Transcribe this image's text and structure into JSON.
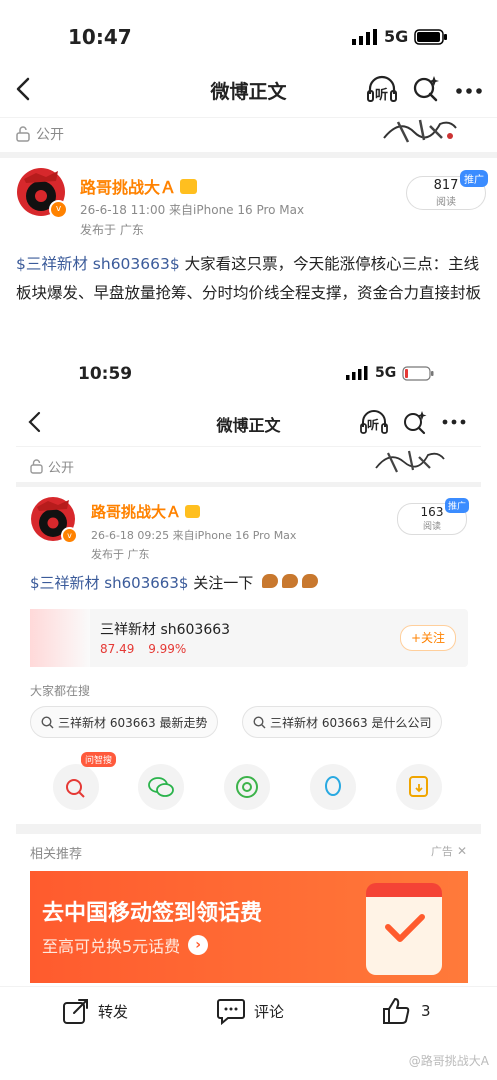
{
  "status_bar": {
    "time": "10:47",
    "network": "5G"
  },
  "nav": {
    "title": "微博正文",
    "listen_label": "听"
  },
  "visibility": {
    "label": "公开"
  },
  "post": {
    "author": "路哥挑战大Ａ",
    "meta": "26-6-18 11:00  来自iPhone 16 Pro Max",
    "location": "发布于 广东",
    "reads_count": "817",
    "reads_label": "阅读",
    "promo_badge": "推广",
    "topic": "$三祥新材 sh603663$",
    "text": " 大家看这只票，今天能涨停核心三点：主线板块爆发、早盘放量抢筹、分时均价线全程支撑，资金合力直接封板"
  },
  "embedded": {
    "status_time": "10:59",
    "network": "5G",
    "nav_title": "微博正文",
    "listen_label": "听",
    "visibility": "公开",
    "author": "路哥挑战大Ａ",
    "meta": "26-6-18 09:25  来自iPhone 16 Pro Max",
    "location": "发布于 广东",
    "reads_count": "163",
    "reads_label": "阅读",
    "promo_badge": "推广",
    "topic": "$三祥新材 sh603663$",
    "text": " 关注一下",
    "stock_name": "三祥新材 sh603663",
    "stock_price": "87.49",
    "stock_change": "9.99%",
    "follow_label": "+关注",
    "search_title": "大家都在搜",
    "search_chips": [
      "三祥新材 603663 最新走势",
      "三祥新材 603663 是什么公司"
    ],
    "ai_badge": "问智搜",
    "related_title": "相关推荐",
    "ad_label": "广告",
    "banner_title": "去中国移动签到领话费",
    "banner_sub": "至高可兑换5元话费"
  },
  "actions": {
    "forward": "转发",
    "comment": "评论",
    "like_count": "3"
  },
  "watermark": "@路哥挑战大A",
  "colors": {
    "accent": "#ff8200",
    "topic_blue": "#3b5b9a",
    "banner": "#ff5722"
  }
}
